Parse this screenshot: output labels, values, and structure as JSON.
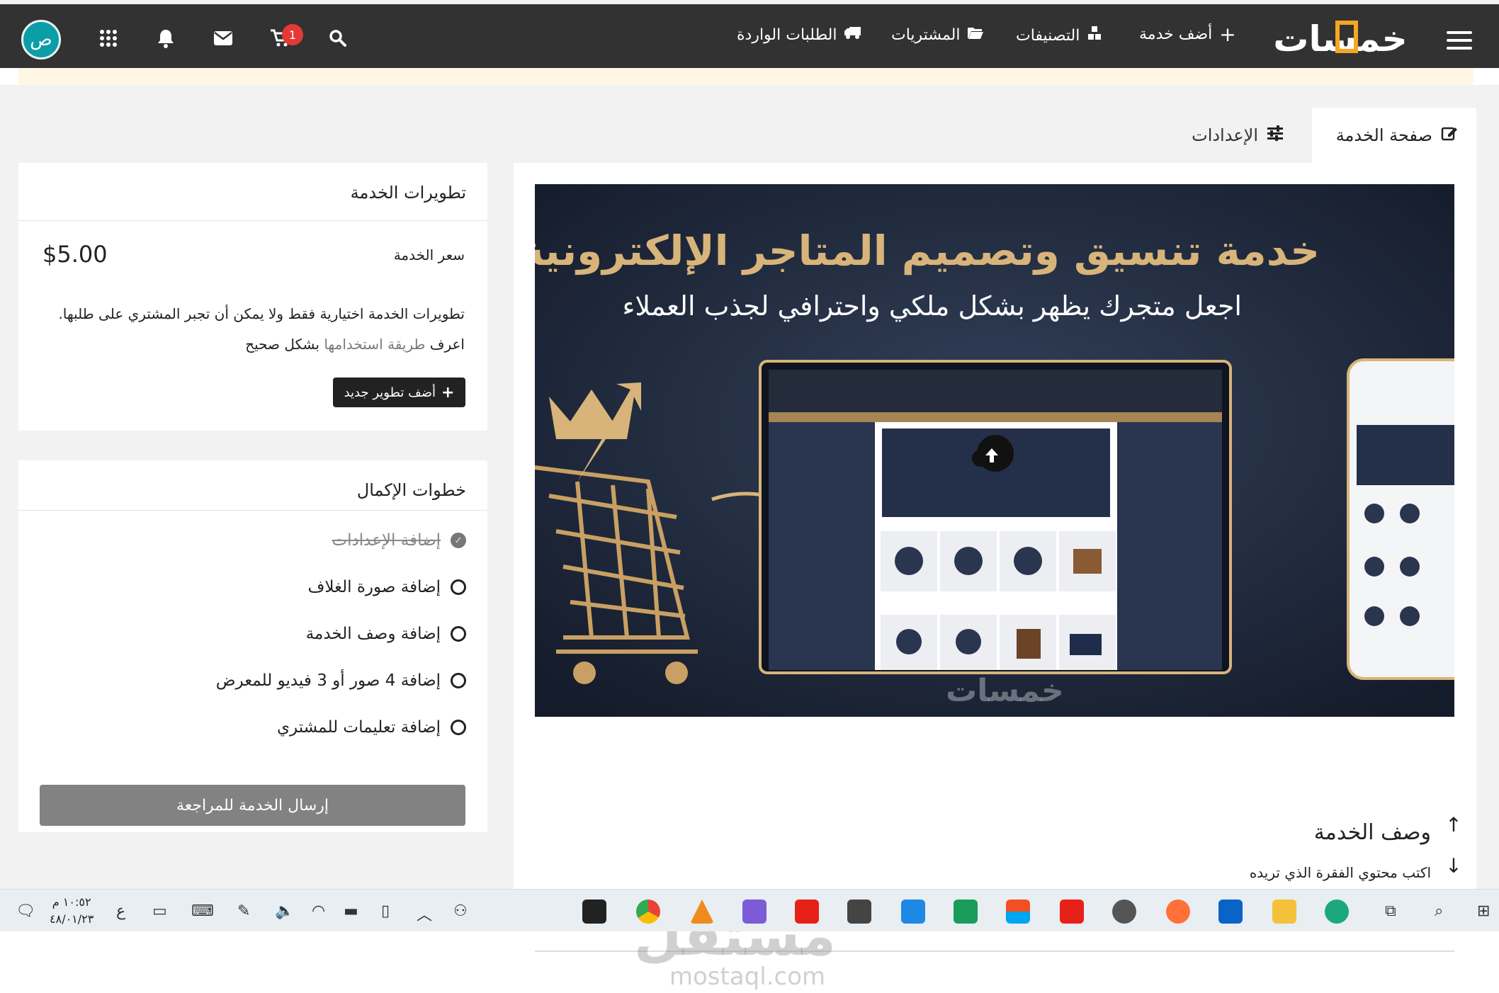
{
  "header": {
    "brand": "خمسات",
    "nav": [
      {
        "label": "أضف خدمة",
        "icon": "plus-icon"
      },
      {
        "label": "التصنيفات",
        "icon": "cubes-icon"
      },
      {
        "label": "المشتريات",
        "icon": "folder-open-icon"
      },
      {
        "label": "الطلبات الواردة",
        "icon": "truck-icon"
      }
    ],
    "cart_count": "1",
    "avatar_letter": "ص"
  },
  "tabs": [
    {
      "label": "صفحة الخدمة",
      "icon": "edit-icon",
      "active": true
    },
    {
      "label": "الإعدادات",
      "icon": "sliders-icon",
      "active": false
    }
  ],
  "cover": {
    "headline": "خدمة تنسيق وتصميم المتاجر الإلكترونية",
    "subheadline": "اجعل متجرك يظهر بشكل ملكي واحترافي لجذب العملاء",
    "footer_logo": "خمسات",
    "upload_icon": "cloud-upload-icon"
  },
  "description": {
    "title": "وصف الخدمة",
    "placeholder": "اكتب محتوي الفقرة الذي تريده"
  },
  "developments": {
    "title": "تطويرات الخدمة",
    "price_label": "سعر الخدمة",
    "price_value": "$5.00",
    "note_line1": "تطويرات الخدمة اختيارية فقط ولا يمكن أن تجبر المشتري على طلبها.",
    "note_prefix": "اعرف",
    "note_link": "طريقة استخدامها",
    "note_suffix": "بشكل صحيح",
    "add_button": "أضف تطوير جديد"
  },
  "steps": {
    "title": "خطوات الإكمال",
    "items": [
      {
        "label": "إضافة الإعدادات",
        "done": true
      },
      {
        "label": "إضافة صورة الغلاف",
        "done": false
      },
      {
        "label": "إضافة وصف الخدمة",
        "done": false
      },
      {
        "label": "إضافة 4 صور أو 3 فيديو للمعرض",
        "done": false
      },
      {
        "label": "إضافة تعليمات للمشتري",
        "done": false
      }
    ],
    "submit_button": "إرسال الخدمة للمراجعة"
  },
  "watermark": {
    "text": "مستقل",
    "sub": "mostaql.com"
  },
  "taskbar": {
    "time": "١٠:٥٢ م",
    "date": "٤٨/٠١/٢٣",
    "lang": "ع"
  },
  "colors": {
    "topbar": "#323232",
    "avatar": "#0c9ea8",
    "badge": "#e53935",
    "accent_close": "#e8883a",
    "brand_gold": "#f5a623"
  }
}
